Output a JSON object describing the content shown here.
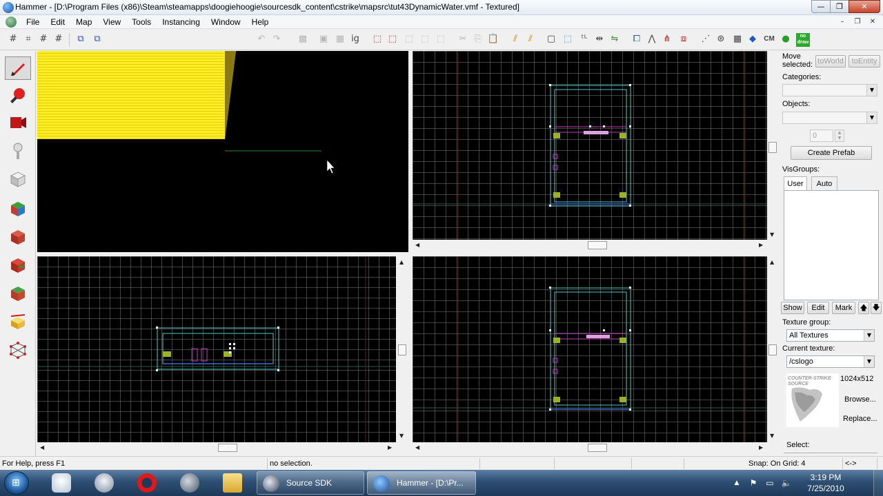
{
  "window": {
    "title": "Hammer - [D:\\Program Files (x86)\\Steam\\steamapps\\doogiehoogie\\sourcesdk_content\\cstrike\\mapsrc\\tut43DynamicWater.vmf - Textured]",
    "min_label": "—",
    "max_label": "❐",
    "close_label": "✕"
  },
  "menu": {
    "items": [
      "File",
      "Edit",
      "Map",
      "View",
      "Tools",
      "Instancing",
      "Window",
      "Help"
    ],
    "mdi_min": "–",
    "mdi_restore": "❐",
    "mdi_close": "✕"
  },
  "toolbar": {
    "cm_label": "CM",
    "nodraw_label": "no draw"
  },
  "right_panel": {
    "move_selected_label": "Move selected:",
    "to_world_label": "toWorld",
    "to_entity_label": "toEntity",
    "categories_label": "Categories:",
    "categories_value": "",
    "objects_label": "Objects:",
    "objects_value": "",
    "count_value": "0",
    "create_prefab_label": "Create Prefab",
    "visgroups_label": "VisGroups:",
    "tab_user": "User",
    "tab_auto": "Auto",
    "show_label": "Show",
    "edit_label": "Edit",
    "mark_label": "Mark",
    "up_label": "🡅",
    "down_label": "🡇",
    "texture_group_label": "Texture group:",
    "texture_group_value": "All Textures",
    "current_texture_label": "Current texture:",
    "current_texture_value": "/cslogo",
    "texture_size": "1024x512",
    "texture_preview_text": "COUNTER-STRIKE SOURCE",
    "browse_label": "Browse...",
    "replace_label": "Replace...",
    "select_label": "Select:"
  },
  "status": {
    "help": "For Help, press F1",
    "selection": "no selection.",
    "snap": "Snap: On Grid: 4",
    "arrows": "<->"
  },
  "taskbar": {
    "tasks": [
      {
        "label": "Source SDK"
      },
      {
        "label": "Hammer - [D:\\Pr..."
      }
    ],
    "time": "3:19 PM",
    "date": "7/25/2010"
  },
  "colors": {
    "viewport_bg": "#000000",
    "grid_line": "#787878",
    "wire_cyan": "#4fc9c9",
    "wire_white": "#ffffff",
    "entity_magenta": "#c040c0",
    "entity_green": "#9ab22a",
    "water_yellow": "#ffee22"
  }
}
